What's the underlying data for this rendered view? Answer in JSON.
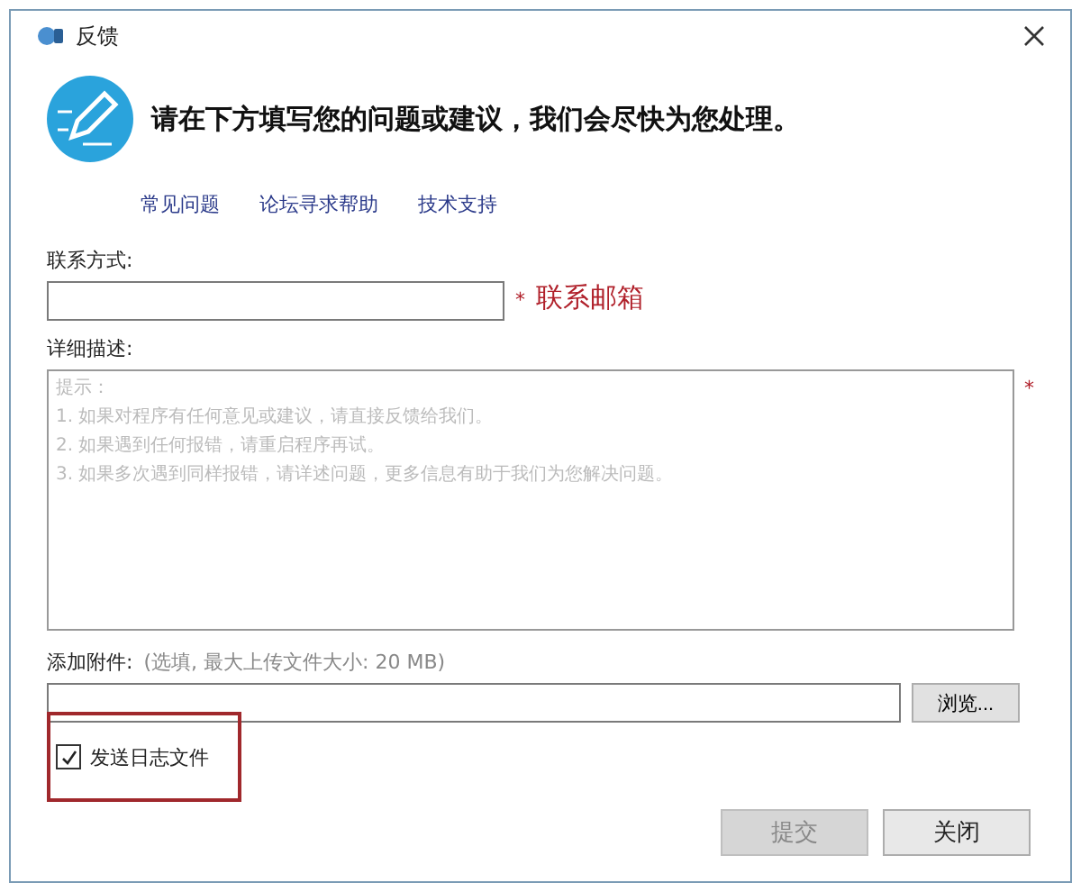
{
  "window": {
    "title": "反馈"
  },
  "header": {
    "text": "请在下方填写您的问题或建议，我们会尽快为您处理。"
  },
  "links": [
    "常见问题",
    "论坛寻求帮助",
    "技术支持"
  ],
  "contact": {
    "label": "联系方式:",
    "required_mark": "*",
    "note": "联系邮箱"
  },
  "description": {
    "label": "详细描述:",
    "required_mark": "*",
    "placeholder": "提示：\n1. 如果对程序有任何意见或建议，请直接反馈给我们。\n2. 如果遇到任何报错，请重启程序再试。\n3. 如果多次遇到同样报错，请详述问题，更多信息有助于我们为您解决问题。"
  },
  "attachment": {
    "label": "添加附件:",
    "hint": "(选填, 最大上传文件大小: 20 MB)",
    "browse": "浏览..."
  },
  "send_log": {
    "label": "发送日志文件",
    "checked": true,
    "highlighted": true
  },
  "buttons": [
    {
      "label": "提交",
      "disabled": true
    },
    {
      "label": "关闭",
      "disabled": false
    }
  ]
}
